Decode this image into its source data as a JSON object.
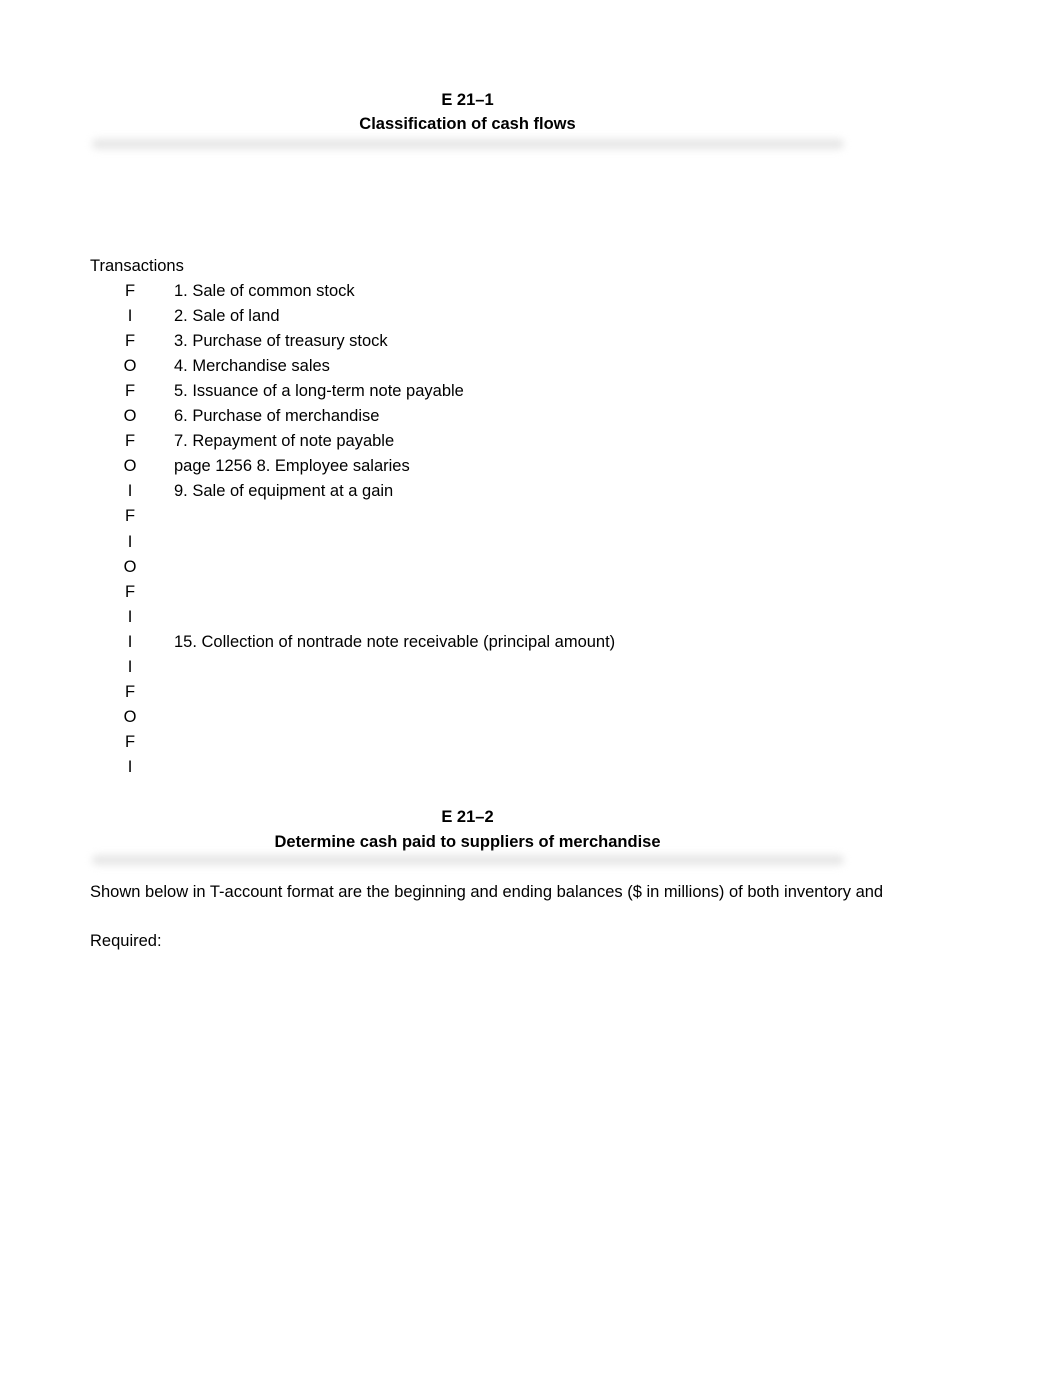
{
  "sections": [
    {
      "id": "E 21–1",
      "title": "Classification of cash flows",
      "list_heading": "Transactions",
      "transactions": [
        {
          "code": "F",
          "description": "1. Sale of common stock"
        },
        {
          "code": "I",
          "description": "2. Sale of land"
        },
        {
          "code": "F",
          "description": "3. Purchase of treasury stock"
        },
        {
          "code": "O",
          "description": "4. Merchandise sales"
        },
        {
          "code": "F",
          "description": "5. Issuance of a long-term note payable"
        },
        {
          "code": "O",
          "description": "6. Purchase of merchandise"
        },
        {
          "code": "F",
          "description": "7. Repayment of note payable"
        },
        {
          "code": "O",
          "description": "page 1256  8. Employee salaries"
        },
        {
          "code": "I",
          "description": "9. Sale of equipment at a gain"
        },
        {
          "code": "F",
          "description": ""
        },
        {
          "code": "I",
          "description": ""
        },
        {
          "code": "O",
          "description": ""
        },
        {
          "code": "F",
          "description": ""
        },
        {
          "code": "I",
          "description": ""
        },
        {
          "code": "I",
          "description": "15. Collection of nontrade note receivable (principal amount)"
        },
        {
          "code": "I",
          "description": ""
        },
        {
          "code": "F",
          "description": ""
        },
        {
          "code": "O",
          "description": ""
        },
        {
          "code": "F",
          "description": ""
        },
        {
          "code": "I",
          "description": ""
        }
      ]
    },
    {
      "id": "E 21–2",
      "title": "Determine cash paid to suppliers of merchandise",
      "body": "Shown below in T-account format are the beginning and ending balances ($ in millions) of both inventory and",
      "required_label": "Required:"
    }
  ]
}
